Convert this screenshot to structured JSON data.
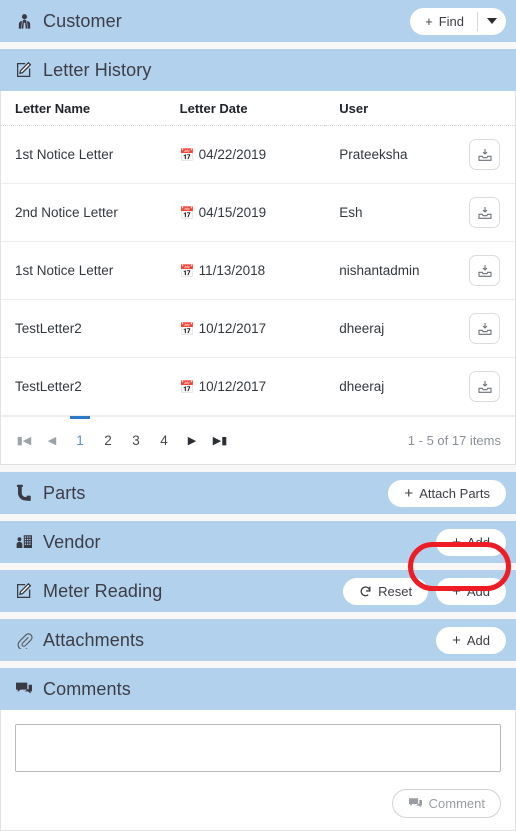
{
  "sections": {
    "customer": {
      "title": "Customer",
      "icon": "user-tie-icon",
      "find_label": "Find",
      "plus": "+",
      "caret_icon": "chevron-down-icon"
    },
    "letter_history": {
      "title": "Letter History",
      "icon": "pencil-square-icon",
      "columns": [
        "Letter Name",
        "Letter Date",
        "User"
      ],
      "rows": [
        {
          "name": "1st Notice Letter",
          "date": "04/22/2019",
          "user": "Prateeksha",
          "action_icon": "download-inbox-icon"
        },
        {
          "name": "2nd Notice Letter",
          "date": "04/15/2019",
          "user": "Esh",
          "action_icon": "download-inbox-icon"
        },
        {
          "name": "1st Notice Letter",
          "date": "11/13/2018",
          "user": "nishantadmin",
          "action_icon": "download-inbox-icon"
        },
        {
          "name": "TestLetter2",
          "date": "10/12/2017",
          "user": "dheeraj",
          "action_icon": "download-inbox-icon"
        },
        {
          "name": "TestLetter2",
          "date": "10/12/2017",
          "user": "dheeraj",
          "action_icon": "download-inbox-icon"
        }
      ],
      "pager": {
        "first_icon": "page-first-icon",
        "prev_icon": "page-prev-icon",
        "pages": [
          "1",
          "2",
          "3",
          "4"
        ],
        "active_page": "1",
        "next_icon": "page-next-icon",
        "last_icon": "page-last-icon",
        "info": "1 - 5 of 17 items"
      }
    },
    "parts": {
      "title": "Parts",
      "icon": "pipe-elbow-icon",
      "button_label": "Attach Parts",
      "plus": "+"
    },
    "vendor": {
      "title": "Vendor",
      "icon": "vendor-building-icon",
      "button_label": "Add",
      "plus": "+"
    },
    "meter_reading": {
      "title": "Meter Reading",
      "icon": "pencil-square-icon",
      "reset_label": "Reset",
      "reset_icon": "refresh-icon",
      "button_label": "Add",
      "plus": "+"
    },
    "attachments": {
      "title": "Attachments",
      "icon": "paperclip-icon",
      "button_label": "Add",
      "plus": "+",
      "highlighted": true,
      "highlight_color": "#ee1c25"
    },
    "comments": {
      "title": "Comments",
      "icon": "comment-bubble-icon",
      "textarea_value": "",
      "textarea_placeholder": "",
      "button_label": "Comment",
      "button_icon": "comment-bubble-icon"
    }
  },
  "theme": {
    "header_blue": "#b1d1ec",
    "page_bg": "#f7f7f7",
    "panel_bg": "#ffffff",
    "active_page_blue": "#2f78c4",
    "annotation_red": "#ee1c25"
  }
}
